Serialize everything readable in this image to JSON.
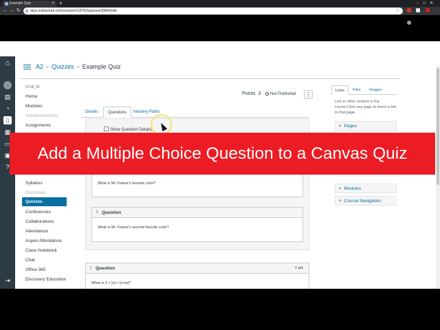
{
  "browser": {
    "tab_title": "Example Quiz",
    "new_tab": "+",
    "window_controls": "–□✕",
    "url": "dcps.instructure.com/courses/119762/quizzes/39840/edit",
    "star": "☆"
  },
  "global_nav": {
    "collapse": "⇥"
  },
  "breadcrumb": {
    "course": "A2",
    "section": "Quizzes",
    "page": "Example Quiz",
    "sep": ">"
  },
  "course_nav": {
    "term": "SY18_20",
    "items": [
      {
        "label": "Home",
        "style": "normal"
      },
      {
        "label": "Modules",
        "style": "normal"
      },
      {
        "label": "Announcements",
        "style": "dim"
      },
      {
        "label": "Assignments",
        "style": "normal"
      },
      {
        "label": "Syllabus",
        "style": "normal"
      },
      {
        "label": "Outcomes",
        "style": "dim"
      },
      {
        "label": "Quizzes",
        "style": "active"
      },
      {
        "label": "Conferences",
        "style": "normal"
      },
      {
        "label": "Collaborations",
        "style": "normal"
      },
      {
        "label": "Attendance",
        "style": "normal"
      },
      {
        "label": "Aspen Attendance",
        "style": "normal"
      },
      {
        "label": "Class Notebook",
        "style": "normal"
      },
      {
        "label": "Chat",
        "style": "normal"
      },
      {
        "label": "Office 365",
        "style": "normal"
      },
      {
        "label": "Discovery Education",
        "style": "normal"
      }
    ]
  },
  "quiz": {
    "points_label": "Points",
    "points_value": "3",
    "status": "Not Published",
    "kebab": "⋮",
    "tabs": [
      "Details",
      "Questions",
      "Mastery Paths"
    ],
    "show_details": "Show Question Details",
    "questions": [
      {
        "header": "",
        "text": "What is Mr. Kaiser's favorite color?",
        "pts": ""
      },
      {
        "header": "Question",
        "text": "What is Mr. Kaiser's second favorite color?",
        "pts": ""
      },
      {
        "header": "Question",
        "text": "What is 3 + [x] + [cow]?",
        "pts": "1 pts"
      }
    ]
  },
  "sidebar": {
    "tabs": [
      "Links",
      "Files",
      "Images"
    ],
    "help": "Link to other content in the course.Click any page to insert a link to that page.",
    "sections": [
      "Pages",
      "Modules",
      "Course Navigation"
    ]
  },
  "banner": {
    "text": "Add a Multiple Choice Question to a Canvas Quiz"
  },
  "colors": {
    "brand": "#0770a3",
    "nav_bg": "#2d3b45",
    "banner": "#ec1c24"
  }
}
